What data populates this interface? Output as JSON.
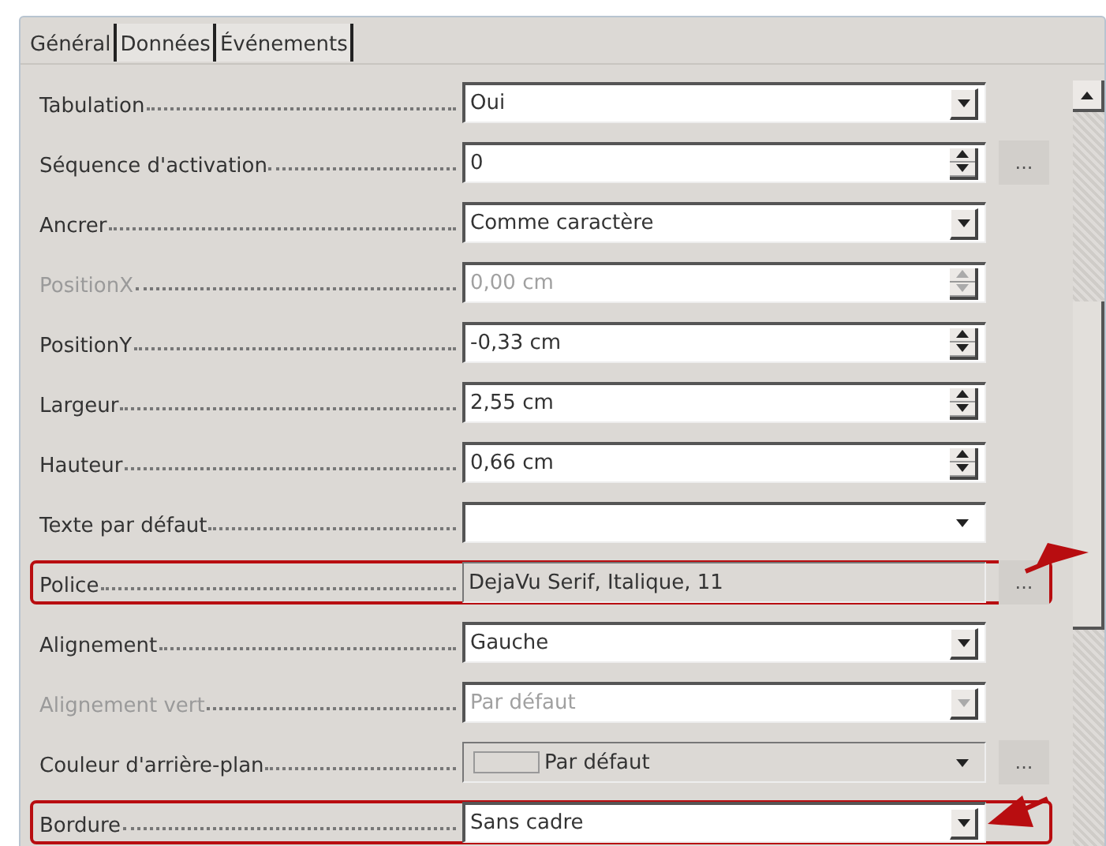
{
  "tabs": [
    {
      "label": "Général",
      "selected": true
    },
    {
      "label": "Données",
      "selected": false
    },
    {
      "label": "Événements",
      "selected": false
    }
  ],
  "properties": [
    {
      "label": "Tabulation",
      "kind": "dropdown",
      "value": "Oui",
      "disabled": false,
      "ellipsis_button": false,
      "highlighted": false
    },
    {
      "label": "Séquence d'activation",
      "kind": "spin",
      "value": "0",
      "disabled": false,
      "ellipsis_button": true,
      "highlighted": false
    },
    {
      "label": "Ancrer",
      "kind": "dropdown",
      "value": "Comme caractère",
      "disabled": false,
      "ellipsis_button": false,
      "highlighted": false
    },
    {
      "label": "PositionX",
      "kind": "spin",
      "value": "0,00 cm",
      "disabled": true,
      "ellipsis_button": false,
      "highlighted": false
    },
    {
      "label": "PositionY",
      "kind": "spin",
      "value": "-0,33 cm",
      "disabled": false,
      "ellipsis_button": false,
      "highlighted": false
    },
    {
      "label": "Largeur",
      "kind": "spin",
      "value": "2,55 cm",
      "disabled": false,
      "ellipsis_button": false,
      "highlighted": false
    },
    {
      "label": "Hauteur",
      "kind": "spin",
      "value": "0,66 cm",
      "disabled": false,
      "ellipsis_button": false,
      "highlighted": false
    },
    {
      "label": "Texte par défaut",
      "kind": "combo",
      "disabled": false,
      "ellipsis_button": false,
      "highlighted": false
    },
    {
      "label": "Police",
      "kind": "font",
      "value": "DejaVu Serif, Italique, 11",
      "disabled": false,
      "ellipsis_button": true,
      "highlighted": true
    },
    {
      "label": "Alignement",
      "kind": "dropdown",
      "value": "Gauche",
      "disabled": false,
      "ellipsis_button": false,
      "highlighted": false
    },
    {
      "label": "Alignement vert",
      "kind": "dropdown",
      "value": "Par défaut",
      "disabled": true,
      "ellipsis_button": false,
      "highlighted": false
    },
    {
      "label": "Couleur d'arrière-plan",
      "kind": "color",
      "value": "Par défaut",
      "disabled": false,
      "ellipsis_button": true,
      "highlighted": false
    },
    {
      "label": "Bordure",
      "kind": "dropdown",
      "value": "Sans cadre",
      "disabled": false,
      "ellipsis_button": false,
      "highlighted": true
    }
  ],
  "ellipsis_label": "..."
}
